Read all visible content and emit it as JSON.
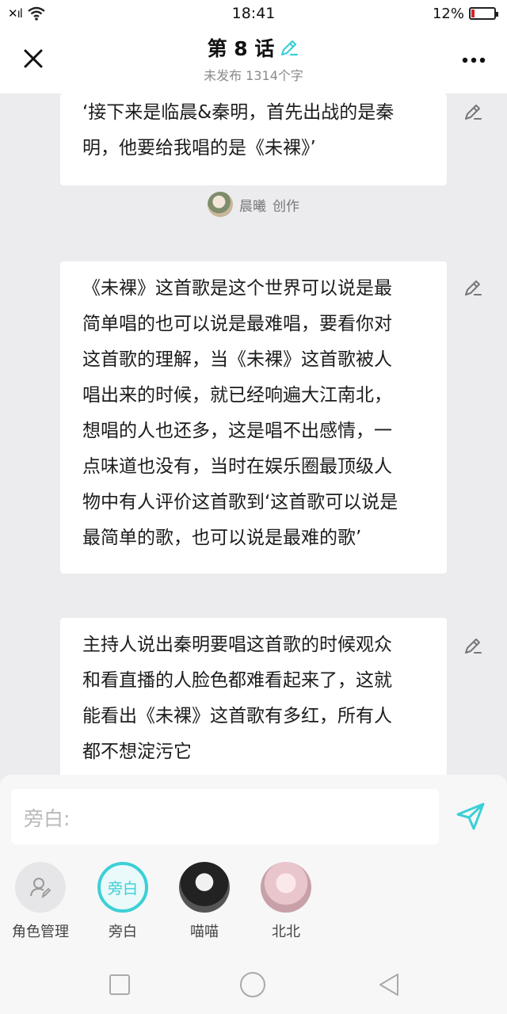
{
  "status_bar": {
    "signal": "✕ıl",
    "time": "18:41",
    "battery_percent": "12%",
    "battery_level": 0.12
  },
  "header": {
    "title": "第 8 话",
    "subtitle": "未发布 1314个字",
    "accent_color": "#3ccfd6"
  },
  "cards": [
    {
      "lines": [
        "‘接下来是临晨&秦明，首先出战的是秦",
        "明，他要给我唱的是《未裸》’"
      ]
    },
    {
      "lines": [
        "《未裸》这首歌是这个世界可以说是最",
        "简单唱的也可以说是最难唱，要看你对",
        "这首歌的理解，当《未裸》这首歌被人",
        "唱出来的时候，就已经响遍大江南北，",
        "想唱的人也还多，这是唱不出感情，一",
        "点味道也没有，当时在娱乐圈最顶级人",
        "物中有人评价这首歌到‘这首歌可以说是",
        "最简单的歌，也可以说是最难的歌’"
      ]
    },
    {
      "lines": [
        "主持人说出秦明要唱这首歌的时候观众",
        "和看直播的人脸色都难看起来了，这就",
        "能看出《未裸》这首歌有多红，所有人",
        "都不想淀污它"
      ]
    }
  ],
  "author": {
    "name": "晨曦",
    "action": "创作"
  },
  "composer": {
    "placeholder": "旁白:",
    "roles": [
      {
        "label": "角色管理",
        "circle_text": ""
      },
      {
        "label": "旁白",
        "circle_text": "旁白"
      },
      {
        "label": "喵喵",
        "circle_text": ""
      },
      {
        "label": "北北",
        "circle_text": ""
      }
    ]
  },
  "icons": {
    "close": "close-icon",
    "more": "more-icon",
    "edit": "pencil-edit-icon",
    "send": "send-icon",
    "role_manage": "user-edit-icon",
    "nav_recent": "square-icon",
    "nav_home": "circle-icon",
    "nav_back": "triangle-back-icon"
  }
}
